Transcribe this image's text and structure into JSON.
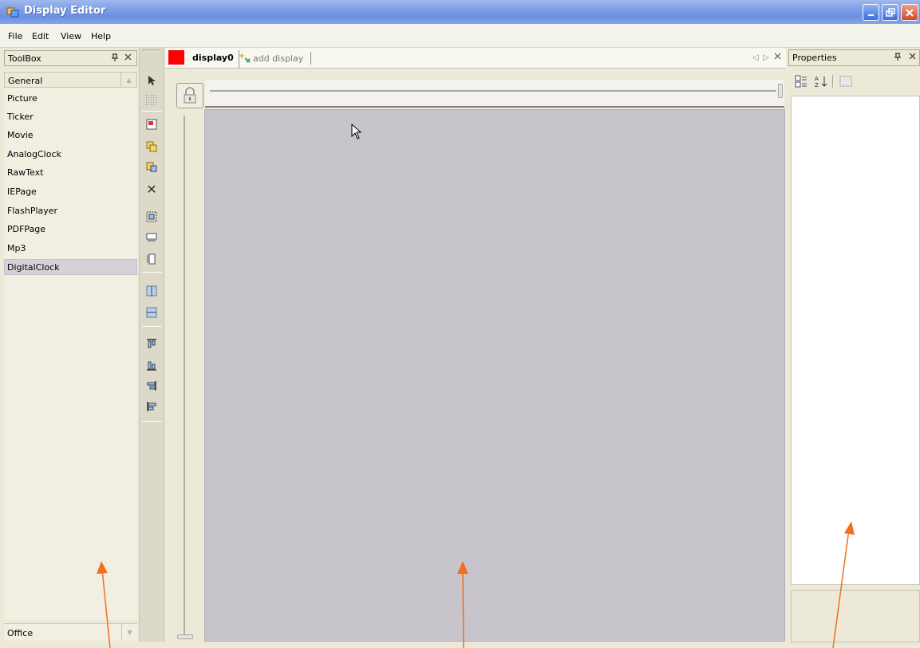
{
  "window": {
    "title": "Display Editor",
    "app_icon": "app-window-icon"
  },
  "menu": {
    "items": [
      "File",
      "Edit",
      "View",
      "Help"
    ]
  },
  "toolbox": {
    "title": "ToolBox",
    "category": "General",
    "items": [
      "Picture",
      "Ticker",
      "Movie",
      "AnalogClock",
      "RawText",
      "IEPage",
      "FlashPlayer",
      "PDFPage",
      "Mp3",
      "DigitalClock"
    ],
    "selected_item": "DigitalClock",
    "bottom_category": "Office"
  },
  "document": {
    "tabs": [
      {
        "label": "display0",
        "active": true
      }
    ],
    "add_tab_label": "add display"
  },
  "properties": {
    "title": "Properties"
  },
  "colors": {
    "accent_red": "#ff0000",
    "design_surface": "#c8c4cc",
    "annotation_arrow": "#f07020"
  }
}
